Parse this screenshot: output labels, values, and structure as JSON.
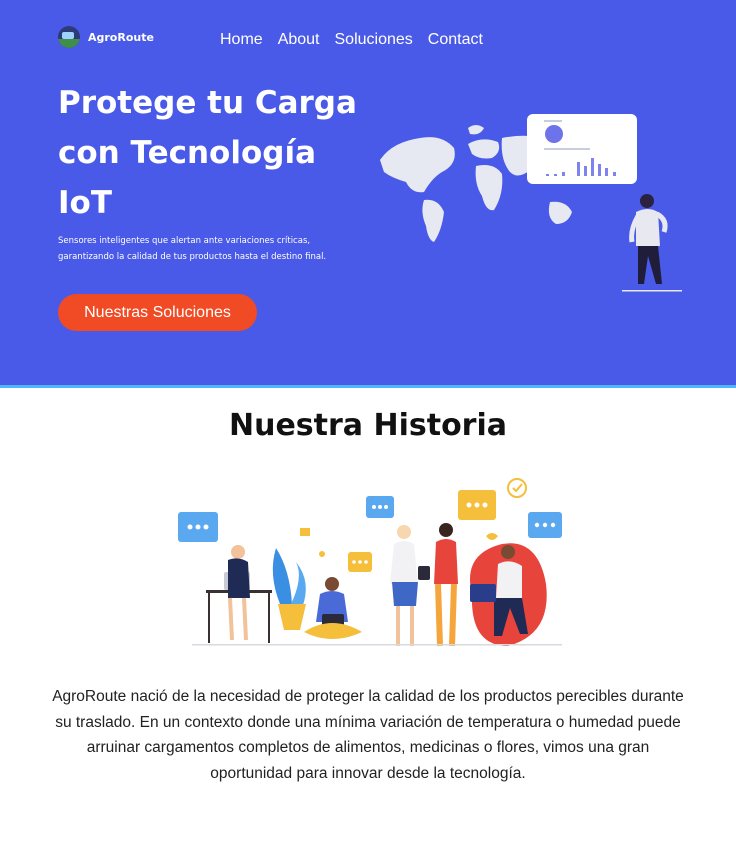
{
  "brand": {
    "name": "AgroRoute",
    "logo_icon": "truck-logo-icon"
  },
  "nav": {
    "items": [
      {
        "label": "Home"
      },
      {
        "label": "About"
      },
      {
        "label": "Soluciones"
      },
      {
        "label": "Contact"
      }
    ]
  },
  "hero": {
    "title": "Protege tu Carga con Tecnología IoT",
    "subtitle": "Sensores inteligentes que alertan ante variaciones críticas, garantizando la calidad de tus productos hasta el destino final.",
    "cta_label": "Nuestras Soluciones",
    "illustration": "world-map-dashboard-illustration"
  },
  "story": {
    "title": "Nuestra Historia",
    "illustration": "team-collaboration-illustration",
    "body": "AgroRoute nació de la necesidad de proteger la calidad de  los productos perecibles durante su traslado. En un contexto donde una  mínima variación de temperatura o humedad puede arruinar cargamentos completos de alimentos, medicinas o flores, vimos una gran oportunidad para innovar desde la tecnología."
  },
  "colors": {
    "hero_bg": "#4a5ae8",
    "hero_border": "#4fb6ff",
    "cta_bg": "#f04b24",
    "text_dark": "#222222"
  }
}
